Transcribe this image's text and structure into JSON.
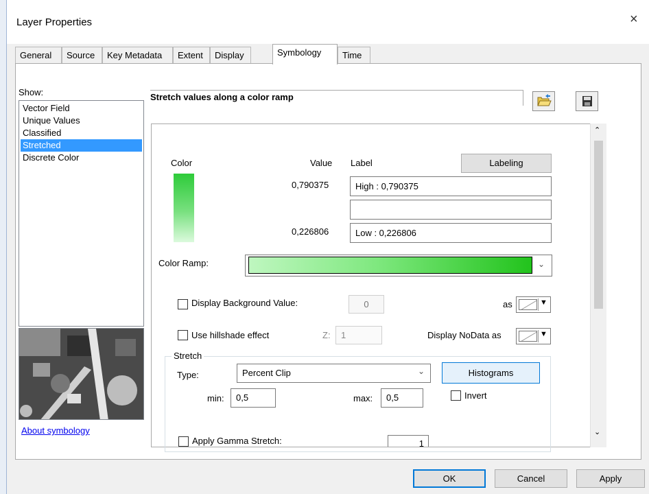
{
  "window": {
    "title": "Layer Properties",
    "close_glyph": "×"
  },
  "tabs": [
    {
      "label": "General"
    },
    {
      "label": "Source"
    },
    {
      "label": "Key Metadata"
    },
    {
      "label": "Extent"
    },
    {
      "label": "Display"
    },
    {
      "label": "Symbology",
      "active": true
    },
    {
      "label": "Time"
    }
  ],
  "show": {
    "label": "Show:",
    "items": [
      "Vector Field",
      "Unique Values",
      "Classified",
      "Stretched",
      "Discrete Color"
    ],
    "selected": "Stretched",
    "about_link": "About symbology"
  },
  "symbology": {
    "heading": "Stretch values along a color ramp",
    "open_icon": "folder-open-icon",
    "save_icon": "save-floppy-icon",
    "color_header": "Color",
    "value_header": "Value",
    "label_header": "Label",
    "labeling_button": "Labeling",
    "high_value": "0,790375",
    "high_label": "High : 0,790375",
    "mid_label": "",
    "low_value": "0,226806",
    "low_label": "Low : 0,226806",
    "color_ramp_label": "Color Ramp:",
    "display_background_label": "Display Background Value:",
    "display_background_value": "0",
    "as_label": "as",
    "hillshade_label": "Use hillshade effect",
    "z_label": "Z:",
    "z_value": "1",
    "nodata_label": "Display NoData as",
    "stretch_group": "Stretch",
    "type_label": "Type:",
    "type_value": "Percent Clip",
    "histograms_button": "Histograms",
    "min_label": "min:",
    "min_value": "0,5",
    "max_label": "max:",
    "max_value": "0,5",
    "invert_label": "Invert",
    "gamma_label": "Apply Gamma Stretch:",
    "gamma_value": "1",
    "colors": {
      "ramp_start": "#bff7c0",
      "ramp_end": "#22c31c",
      "selection": "#3399ff"
    }
  },
  "buttons": {
    "ok": "OK",
    "cancel": "Cancel",
    "apply": "Apply"
  }
}
